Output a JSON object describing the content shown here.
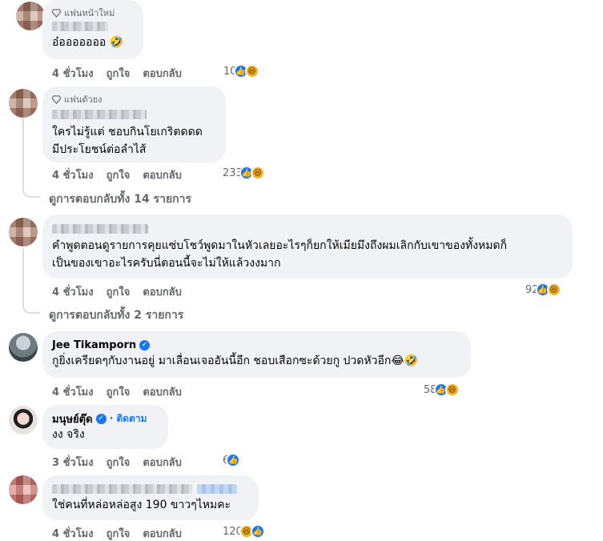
{
  "comments": [
    {
      "badge": "แฟนหน้าใหม่",
      "text": "อ๋อออออออ 🤣",
      "time": "4 ชั่วโมง",
      "like": "ถูกใจ",
      "reply": "ตอบกลับ",
      "reaction_count": "10",
      "reactions": [
        "like-icon",
        "haha-icon"
      ]
    },
    {
      "badge": "แฟนตัวยง",
      "text": "ใครไม่รู้แต่ ชอบกินโยเกริตดดด\nมีประโยชน์ต่อลำไส้",
      "time": "4 ชั่วโมง",
      "like": "ถูกใจ",
      "reply": "ตอบกลับ",
      "reaction_count": "233",
      "reactions": [
        "like-icon",
        "haha-icon"
      ],
      "view_replies": "ดูการตอบกลับทั้ง 14 รายการ"
    },
    {
      "text": "คำพูดตอนดูรายการคุยแซ่บโชว์พูดมาในหัวเลยอะไรๆก็ยกให้เมียมึงถึงผมเลิกกับเขาของทั้งหมดก็\nเป็นของเขาอะไรครับนี่ตอนนี้จะไม่ให้แล้วงงมาก",
      "time": "4 ชั่วโมง",
      "like": "ถูกใจ",
      "reply": "ตอบกลับ",
      "reaction_count": "92",
      "reactions": [
        "like-icon",
        "haha-icon"
      ],
      "view_replies": "ดูการตอบกลับทั้ง 2 รายการ"
    },
    {
      "name": "Jee Tikamporn",
      "text": "กูยิ่งเครียดๆกับงานอยู่ มาเลื่อนเจออันนี้อีก ชอบเสือกซะด้วยกู ปวดหัวอีก😂🤣",
      "time": "4 ชั่วโมง",
      "like": "ถูกใจ",
      "reply": "ตอบกลับ",
      "reaction_count": "58",
      "reactions": [
        "like-icon",
        "haha-icon"
      ]
    },
    {
      "name": "มนุษย์ตุ๊ด",
      "follow": "ติดตาม",
      "text": "งง จริง",
      "time": "3 ชั่วโมง",
      "like": "ถูกใจ",
      "reply": "ตอบกลับ",
      "reaction_count": "6",
      "reactions": [
        "like-icon"
      ]
    },
    {
      "text": "ใช่คนที่หล่อหล่อสูง 190 ขาวๆไหมคะ",
      "time": "4 ชั่วโมง",
      "like": "ถูกใจ",
      "reply": "ตอบกลับ",
      "reaction_count": "120",
      "reactions": [
        "haha-icon",
        "like-icon"
      ]
    }
  ]
}
